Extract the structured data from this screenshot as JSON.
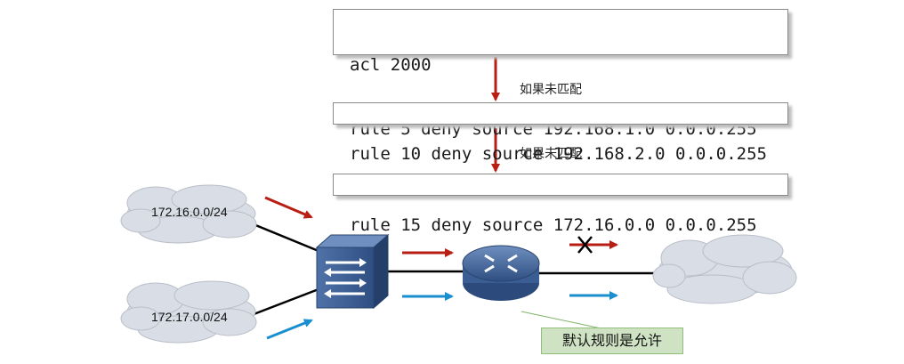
{
  "acl": {
    "box1": {
      "line1": "acl 2000",
      "line2": "rule 5 deny source 192.168.1.0 0.0.0.255"
    },
    "box2": {
      "line1": "rule 10 deny source 192.168.2.0 0.0.0.255"
    },
    "box3": {
      "line1": "rule 15 deny source 172.16.0.0 0.0.0.255"
    }
  },
  "flow_labels": {
    "first": "如果未匹配",
    "second": "如果未匹配"
  },
  "networks": {
    "top_left": "172.16.0.0/24",
    "bottom_left": "172.17.0.0/24"
  },
  "note": "默认规则是允许",
  "colors": {
    "deny_arrow": "#b81e14",
    "permit_arrow": "#1a8fcf",
    "device": "#4a6ea4",
    "cloud": "#d9dde5",
    "note_fill": "#cfe2c3"
  },
  "icons": {
    "switch": "switch-icon",
    "router": "router-icon",
    "blocked": "x-mark-icon"
  }
}
